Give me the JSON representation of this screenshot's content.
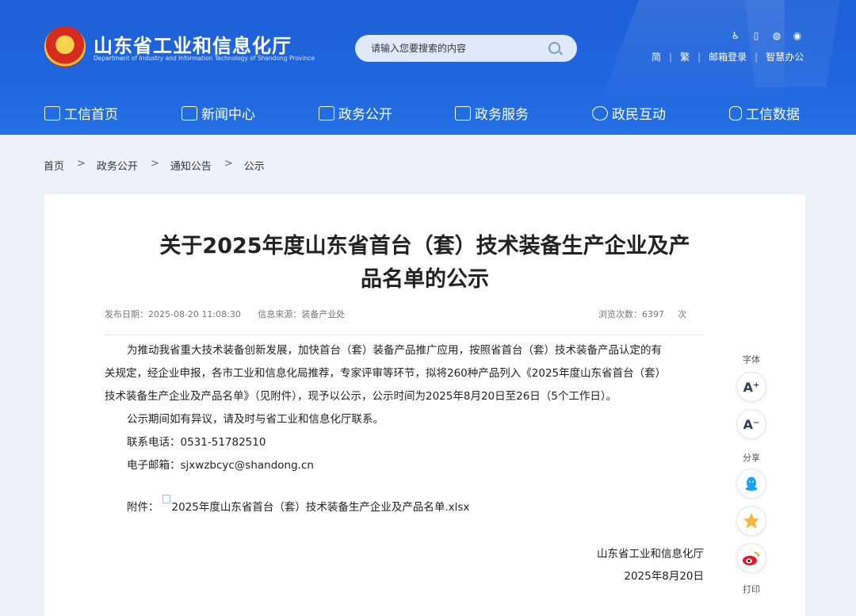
{
  "header": {
    "site_name": "山东省工业和信息化厅",
    "site_name_en": "Department of Industry and Information Technology of Shandong Province",
    "search_placeholder": "请输入您要搜索的内容",
    "top_icons": [
      "accessibility-icon",
      "mobile-icon",
      "wechat-icon",
      "weibo-icon"
    ],
    "top_links": [
      "简",
      "繁",
      "邮箱登录",
      "智慧办公"
    ]
  },
  "nav": {
    "items": [
      {
        "label": "工信首页",
        "icon": "home-icon"
      },
      {
        "label": "新闻中心",
        "icon": "news-icon"
      },
      {
        "label": "政务公开",
        "icon": "gov-open-icon"
      },
      {
        "label": "政务服务",
        "icon": "service-icon"
      },
      {
        "label": "政民互动",
        "icon": "chat-icon"
      },
      {
        "label": "工信数据",
        "icon": "database-icon"
      }
    ]
  },
  "breadcrumb": {
    "items": [
      "首页",
      "政务公开",
      "通知公告",
      "公示"
    ],
    "separator": ">"
  },
  "article": {
    "title_line1": "关于2025年度山东省首台（套）技术装备生产企业及产",
    "title_line2": "品名单的公示",
    "publish_label": "发布日期：",
    "publish_date": "2025-08-20 11:08:30",
    "source_label": "信息来源：",
    "source": "装备产业处",
    "views_label": "浏览次数：",
    "views": "6397",
    "views_unit": "次",
    "paragraph1_line1": "为推动我省重大技术装备创新发展，加快首台（套）装备产品推广应用，按照省首台（套）技术装备产品认定的有",
    "paragraph1_line2": "关规定，经企业申报，各市工业和信息化局推荐，专家评审等环节，拟将260种产品列入《2025年度山东省首台（套）",
    "paragraph1_line3": "技术装备生产企业及产品名单》（见附件），现予以公示，公示时间为2025年8月20日至26日（5个工作日）。",
    "paragraph2": "公示期间如有异议，请及时与省工业和信息化厅联系。",
    "phone_label": "联系电话：",
    "phone": "0531-51782510",
    "email_label": "电子邮箱：",
    "email": "sjxwzbcyc@shandong.cn",
    "attachment_label": "附件：",
    "attachment_file": "2025年度山东省首台（套）技术装备生产企业及产品名单.xlsx",
    "signature_org": "山东省工业和信息化厅",
    "signature_date": "2025年8月20日"
  },
  "side_tools": {
    "font_label": "字体",
    "font_increase": "A⁺",
    "font_decrease": "A⁻",
    "share_label": "分享",
    "share_icons": [
      "qq-icon",
      "qzone-icon",
      "weibo-icon"
    ],
    "print_label": "打印"
  },
  "colors": {
    "header_blue": "#1f66de",
    "page_bg": "#eef2f8",
    "weibo_red": "#e6162d",
    "qq_blue": "#1aa0f2",
    "qzone_yellow": "#f6b53c"
  }
}
